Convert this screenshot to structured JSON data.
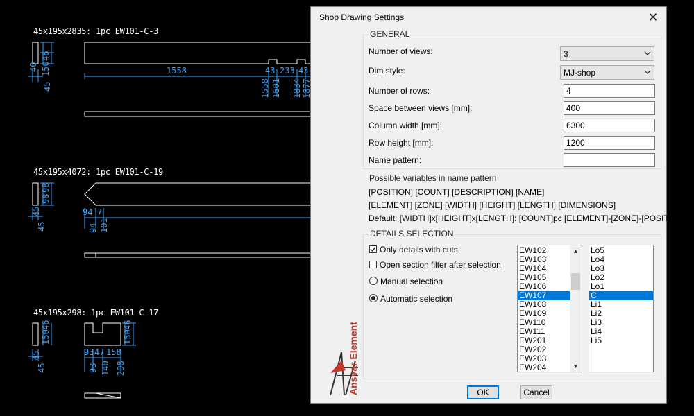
{
  "cad": {
    "titles": [
      "45x195x2835: 1pc EW101-C-3",
      "45x195x4072: 1pc EW101-C-19",
      "45x195x298: 1pc EW101-C-17"
    ],
    "dims": {
      "d1": "40",
      "d2": "45",
      "d3": "46",
      "d4": "150",
      "d5": "1558",
      "d6": "43",
      "d7": "233",
      "d8": "43",
      "d9": "1558",
      "d10": "1601",
      "d11": "1834",
      "d12": "1877",
      "e1": "45",
      "e2": "45",
      "e3": "98",
      "e4": "98",
      "e5": "94",
      "e6": "7",
      "e7": "94",
      "e8": "101",
      "f1": "45",
      "f2": "45",
      "f3": "150",
      "f4": "46",
      "f5": "150",
      "f6": "46",
      "f7": "93",
      "f8": "47",
      "f9": "158",
      "f10": "93",
      "f11": "140",
      "f12": "298"
    },
    "colors": {
      "line": "#ffffff",
      "dim": "#3aa6ff"
    }
  },
  "dialog": {
    "title": "Shop Drawing Settings",
    "close_icon": "close-icon",
    "logo_text": "Ansvar Element",
    "general": {
      "title": "GENERAL",
      "num_views_label": "Number of views:",
      "num_views_value": "3",
      "dim_style_label": "Dim style:",
      "dim_style_value": "MJ-shop",
      "num_rows_label": "Number of rows:",
      "num_rows_value": "4",
      "space_label": "Space between views [mm]:",
      "space_value": "400",
      "col_width_label": "Column width [mm]:",
      "col_width_value": "6300",
      "row_height_label": "Row height [mm]:",
      "row_height_value": "1200",
      "name_pattern_label": "Name pattern:",
      "name_pattern_value": ""
    },
    "variables": {
      "title": "Possible variables in name pattern",
      "line1": "[POSITION] [COUNT] [DESCRIPTION] [NAME]",
      "line2": "[ELEMENT] [ZONE] [WIDTH] [HEIGHT] [LENGTH] [DIMENSIONS]",
      "line3": "Default: [WIDTH]x[HEIGHT]x[LENGTH]: [COUNT]pc [ELEMENT]-[ZONE]-[POSITION]"
    },
    "details": {
      "title": "DETAILS SELECTION",
      "only_cuts_label": "Only details with cuts",
      "only_cuts_checked": true,
      "open_filter_label": "Open section filter after selection",
      "open_filter_checked": false,
      "manual_label": "Manual selection",
      "automatic_label": "Automatic selection",
      "selected_mode": "automatic",
      "elements": [
        "EW102",
        "EW103",
        "EW104",
        "EW105",
        "EW106",
        "EW107",
        "EW108",
        "EW109",
        "EW110",
        "EW111",
        "EW201",
        "EW202",
        "EW203",
        "EW204"
      ],
      "selected_element": "EW107",
      "zones": [
        "Lo5",
        "Lo4",
        "Lo3",
        "Lo2",
        "Lo1",
        "C",
        "Li1",
        "Li2",
        "Li3",
        "Li4",
        "Li5"
      ],
      "selected_zone": "C"
    },
    "ok_label": "OK",
    "cancel_label": "Cancel",
    "colors": {
      "selection": "#0078d7",
      "face": "#f0f0f0"
    }
  }
}
